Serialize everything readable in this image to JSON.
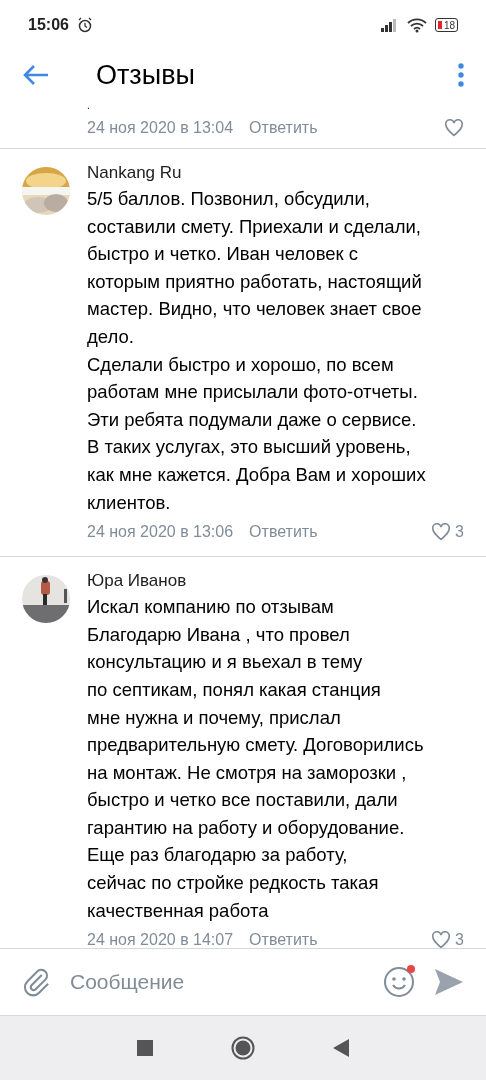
{
  "status_bar": {
    "time": "15:06",
    "battery": "18"
  },
  "header": {
    "title": "Отзывы"
  },
  "comments": [
    {
      "kind": "tail",
      "text": ".",
      "date": "24 ноя 2020 в 13:04",
      "reply": "Ответить"
    },
    {
      "kind": "full",
      "author": "Nankang Ru",
      "text": "5/5 баллов. Позвонил, обсудили,\nсоставили смету. Приехали и сделали,\nбыстро и четко. Иван человек с\nкоторым приятно работать, настоящий\nмастер. Видно, что человек знает свое\nдело.\nСделали быстро и хорошо, по всем\nработам мне присылали фото-отчеты.\nЭти ребята подумали даже о сервисе.\nВ таких услугах, это высший уровень,\nкак мне кажется. Добра Вам и хороших\nклиентов.",
      "date": "24 ноя 2020 в 13:06",
      "reply": "Ответить",
      "likes": "3"
    },
    {
      "kind": "full",
      "author": "Юра Иванов",
      "text": "Искал компанию по отзывам\nБлагодарю Ивана , что провел\nконсультацию и я вьехал в тему\nпо септикам, понял какая станция\nмне нужна и почему, прислал\nпредварительную смету. Договорились\nна монтаж. Не смотря на заморозки ,\nбыстро и четко все поставили, дали\nгарантию на работу и оборудование.\nЕще раз благодарю за работу,\nсейчас по стройке редкость такая\nкачественная работа",
      "date": "24 ноя 2020 в 14:07",
      "reply": "Ответить",
      "likes": "3"
    }
  ],
  "composer": {
    "placeholder": "Сообщение",
    "emoji_badge": true
  }
}
